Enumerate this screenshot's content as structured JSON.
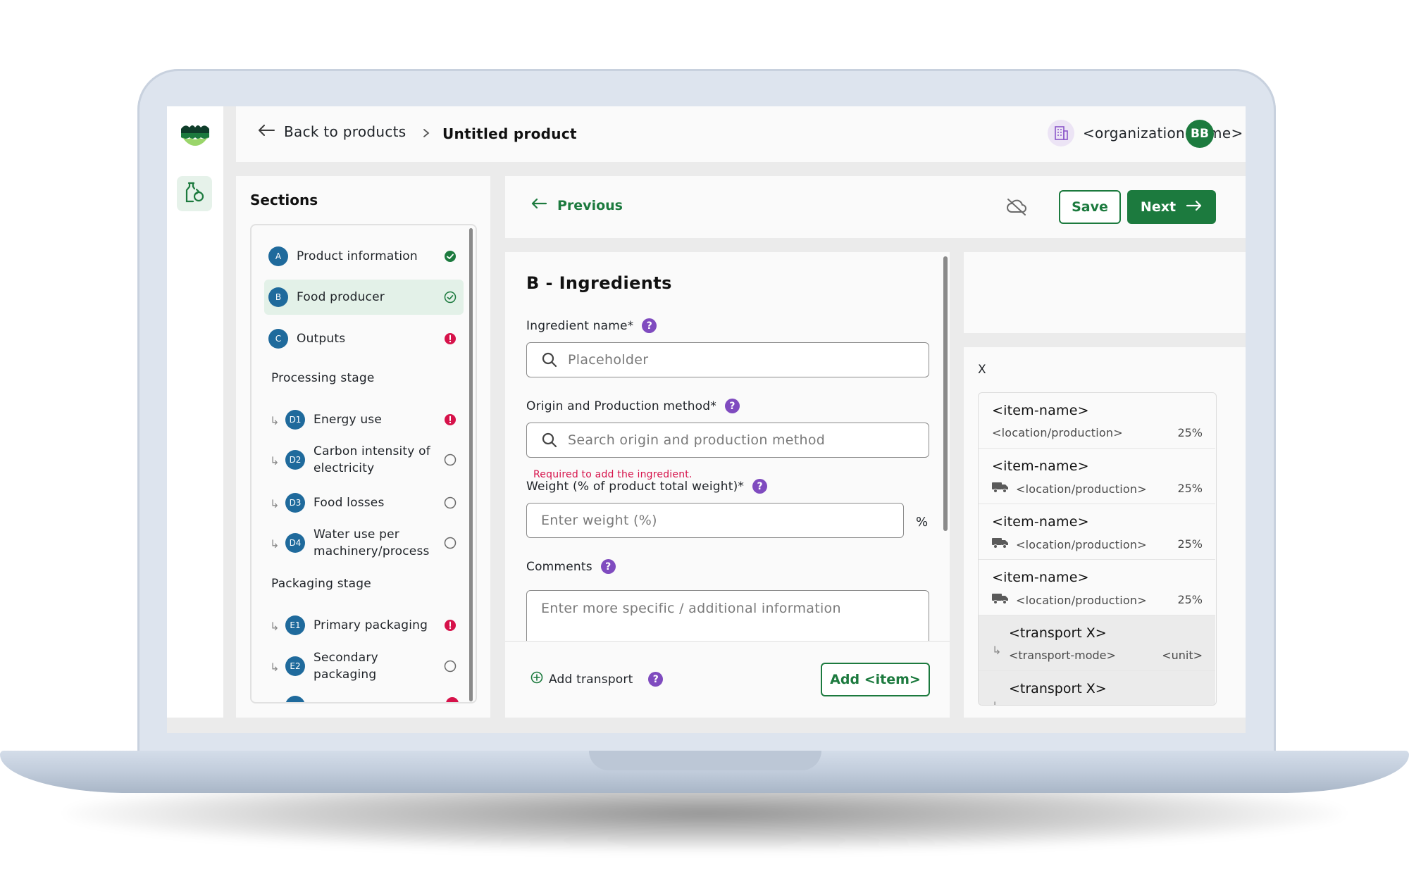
{
  "colors": {
    "primary_green": "#1c7a3e",
    "badge_blue": "#1f6a9c",
    "error_red": "#d6124a",
    "help_purple": "#7f4bbf"
  },
  "header": {
    "back_label": "Back to products",
    "current_page": "Untitled product",
    "organization": "<organization-name>",
    "avatar_initials": "BB"
  },
  "sections": {
    "title": "Sections",
    "items": [
      {
        "badge": "A",
        "label": "Product information",
        "status": "complete"
      },
      {
        "badge": "B",
        "label": "Food producer",
        "status": "complete-outline"
      },
      {
        "badge": "C",
        "label": "Outputs",
        "status": "error"
      }
    ],
    "processing_stage_label": "Processing stage",
    "processing_items": [
      {
        "badge": "D1",
        "label": "Energy use",
        "status": "error"
      },
      {
        "badge": "D2",
        "label_line1": "Carbon intensity of",
        "label_line2": "electricity",
        "status": "empty"
      },
      {
        "badge": "D3",
        "label": "Food losses",
        "status": "empty"
      },
      {
        "badge": "D4",
        "label_line1": "Water use per",
        "label_line2": "machinery/process",
        "status": "empty"
      }
    ],
    "packaging_stage_label": "Packaging stage",
    "packaging_items": [
      {
        "badge": "E1",
        "label": "Primary packaging",
        "status": "error"
      },
      {
        "badge": "E2",
        "label_line1": "Secondary",
        "label_line2": "packaging",
        "status": "empty"
      }
    ]
  },
  "actions": {
    "previous_label": "Previous",
    "save_label": "Save",
    "next_label": "Next"
  },
  "form": {
    "title": "B - Ingredients",
    "ingredient_label": "Ingredient name*",
    "ingredient_placeholder": "Placeholder",
    "origin_label": "Origin and Production method*",
    "origin_placeholder": "Search origin and production method",
    "origin_error": "Required to add the ingredient.",
    "weight_label": "Weight (% of product total weight)*",
    "weight_placeholder": "Enter weight (%)",
    "weight_unit": "%",
    "comments_label": "Comments",
    "comments_placeholder": "Enter more specific / additional information",
    "add_transport_label": "Add transport",
    "add_item_label": "Add <item>"
  },
  "side_panel": {
    "header": "X",
    "items": [
      {
        "name": "<item-name>",
        "sub": "<location/production>",
        "pct": "25%",
        "truck": false
      },
      {
        "name": "<item-name>",
        "sub": "<location/production>",
        "pct": "25%",
        "truck": true
      },
      {
        "name": "<item-name>",
        "sub": "<location/production>",
        "pct": "25%",
        "truck": true
      },
      {
        "name": "<item-name>",
        "sub": "<location/production>",
        "pct": "25%",
        "truck": true
      }
    ],
    "transports": [
      {
        "name": "<transport X>",
        "mode": "<transport-mode>",
        "unit": "<unit>"
      },
      {
        "name": "<transport X>"
      }
    ]
  }
}
